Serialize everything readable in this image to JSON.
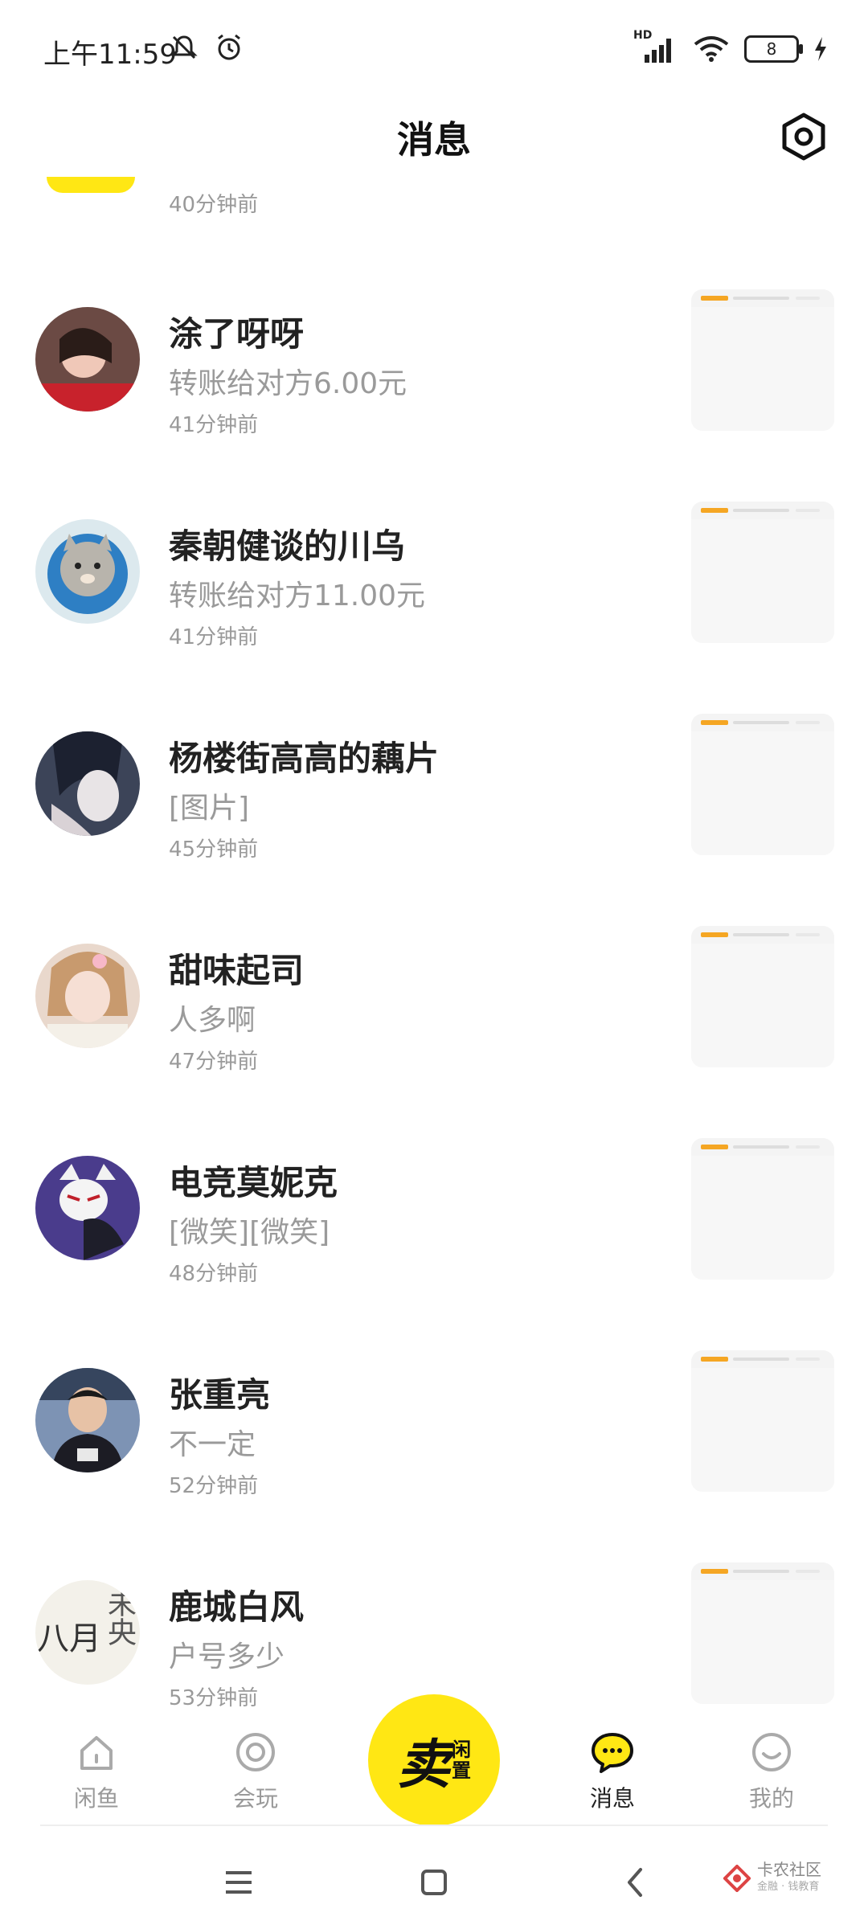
{
  "status_bar": {
    "time": "上午11:59",
    "network": "HD",
    "battery": "8"
  },
  "header": {
    "title": "消息"
  },
  "partial_item": {
    "time": "40分钟前"
  },
  "conversations": [
    {
      "name": "涂了呀呀",
      "preview": "转账给对方6.00元",
      "time": "41分钟前"
    },
    {
      "name": "秦朝健谈的川乌",
      "preview": "转账给对方11.00元",
      "time": "41分钟前"
    },
    {
      "name": "杨楼街高高的藕片",
      "preview": "[图片]",
      "time": "45分钟前"
    },
    {
      "name": "甜味起司",
      "preview": "人多啊",
      "time": "47分钟前"
    },
    {
      "name": "电竞莫妮克",
      "preview": "[微笑][微笑]",
      "time": "48分钟前"
    },
    {
      "name": "张重亮",
      "preview": "不一定",
      "time": "52分钟前"
    },
    {
      "name": "鹿城白风",
      "preview": "户号多少",
      "time": "53分钟前"
    }
  ],
  "avatar_texts": {
    "cal_1": "八月",
    "cal_2": "未央"
  },
  "tabbar": {
    "home": "闲鱼",
    "play": "会玩",
    "sell_main": "卖",
    "sell_sub_1": "闲",
    "sell_sub_2": "置",
    "messages": "消息",
    "mine": "我的"
  },
  "watermark": {
    "title": "卡农社区",
    "subtitle": "金融 · 钱教育"
  },
  "colors": {
    "brand_yellow": "#ffe714",
    "text_primary": "#222222",
    "text_secondary": "#9a9a9a"
  }
}
